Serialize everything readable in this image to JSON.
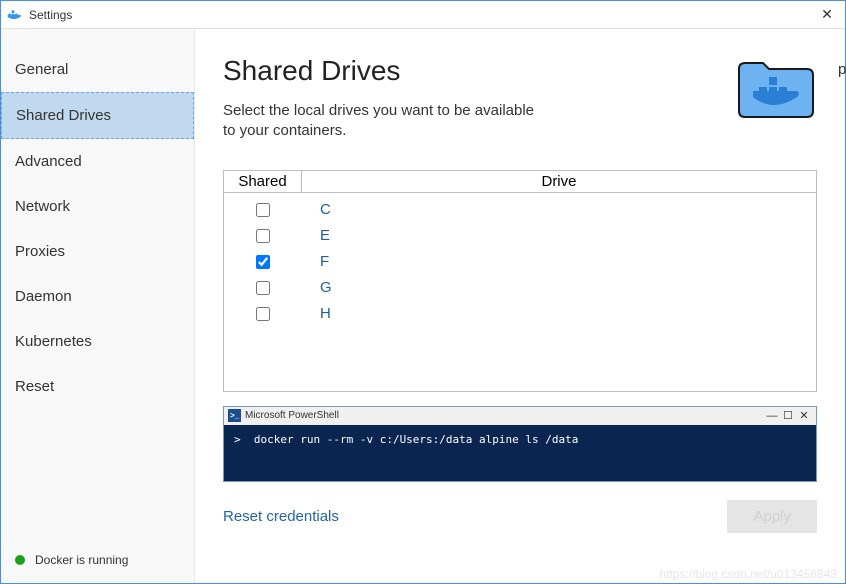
{
  "window": {
    "title": "Settings",
    "close_glyph": "✕"
  },
  "sidebar": {
    "items": [
      {
        "label": "General",
        "selected": false
      },
      {
        "label": "Shared Drives",
        "selected": true
      },
      {
        "label": "Advanced",
        "selected": false
      },
      {
        "label": "Network",
        "selected": false
      },
      {
        "label": "Proxies",
        "selected": false
      },
      {
        "label": "Daemon",
        "selected": false
      },
      {
        "label": "Kubernetes",
        "selected": false
      },
      {
        "label": "Reset",
        "selected": false
      }
    ],
    "status_text": "Docker is running",
    "status_color": "#1aa01a"
  },
  "main": {
    "title": "Shared Drives",
    "description": "Select the local drives you want to be available to your containers.",
    "table": {
      "col_shared": "Shared",
      "col_drive": "Drive",
      "rows": [
        {
          "drive": "C",
          "shared": false
        },
        {
          "drive": "E",
          "shared": false
        },
        {
          "drive": "F",
          "shared": true
        },
        {
          "drive": "G",
          "shared": false
        },
        {
          "drive": "H",
          "shared": false
        }
      ]
    },
    "powershell": {
      "title": "Microsoft PowerShell",
      "min_glyph": "—",
      "max_glyph": "☐",
      "close_glyph": "✕",
      "command": ">  docker run --rm -v c:/Users:/data alpine ls /data"
    },
    "reset_link": "Reset credentials",
    "apply_label": "Apply"
  },
  "watermark": "https://blog.csdn.net/u013456843",
  "cropped_char": "p"
}
